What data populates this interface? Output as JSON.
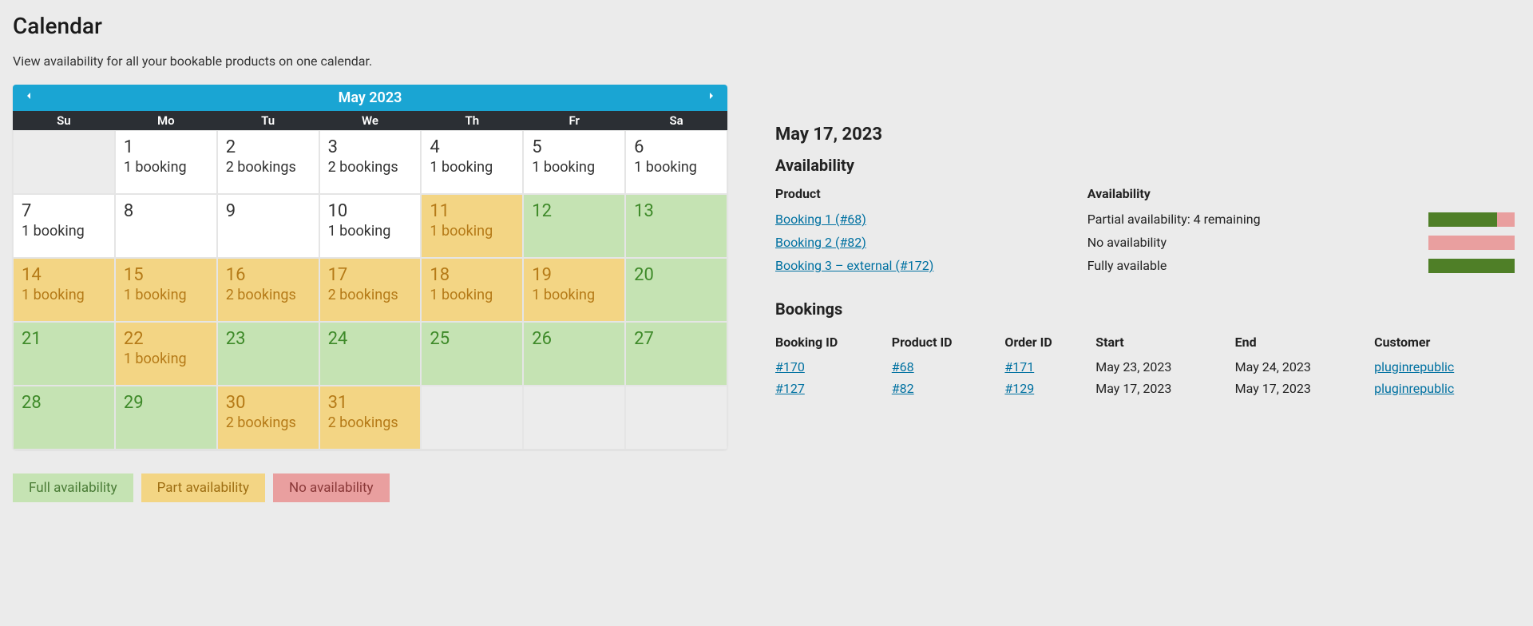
{
  "page": {
    "title": "Calendar",
    "subtitle": "View availability for all your bookable products on one calendar."
  },
  "calendar": {
    "month_label": "May 2023",
    "day_headers": [
      "Su",
      "Mo",
      "Tu",
      "We",
      "Th",
      "Fr",
      "Sa"
    ],
    "cells": [
      {
        "day": "",
        "status": "blank",
        "text": ""
      },
      {
        "day": "1",
        "status": "none",
        "text": "1 booking"
      },
      {
        "day": "2",
        "status": "none",
        "text": "2 bookings"
      },
      {
        "day": "3",
        "status": "none",
        "text": "2 bookings"
      },
      {
        "day": "4",
        "status": "none",
        "text": "1 booking"
      },
      {
        "day": "5",
        "status": "none",
        "text": "1 booking"
      },
      {
        "day": "6",
        "status": "none",
        "text": "1 booking"
      },
      {
        "day": "7",
        "status": "none",
        "text": "1 booking"
      },
      {
        "day": "8",
        "status": "none",
        "text": ""
      },
      {
        "day": "9",
        "status": "none",
        "text": ""
      },
      {
        "day": "10",
        "status": "none",
        "text": "1 booking"
      },
      {
        "day": "11",
        "status": "orange",
        "text": "1 booking"
      },
      {
        "day": "12",
        "status": "green",
        "text": ""
      },
      {
        "day": "13",
        "status": "green",
        "text": ""
      },
      {
        "day": "14",
        "status": "orange",
        "text": "1 booking"
      },
      {
        "day": "15",
        "status": "orange",
        "text": "1 booking"
      },
      {
        "day": "16",
        "status": "orange",
        "text": "2 bookings"
      },
      {
        "day": "17",
        "status": "orange",
        "text": "2 bookings"
      },
      {
        "day": "18",
        "status": "orange",
        "text": "1 booking"
      },
      {
        "day": "19",
        "status": "orange",
        "text": "1 booking"
      },
      {
        "day": "20",
        "status": "green",
        "text": ""
      },
      {
        "day": "21",
        "status": "green",
        "text": ""
      },
      {
        "day": "22",
        "status": "orange",
        "text": "1 booking"
      },
      {
        "day": "23",
        "status": "green",
        "text": ""
      },
      {
        "day": "24",
        "status": "green",
        "text": ""
      },
      {
        "day": "25",
        "status": "green",
        "text": ""
      },
      {
        "day": "26",
        "status": "green",
        "text": ""
      },
      {
        "day": "27",
        "status": "green",
        "text": ""
      },
      {
        "day": "28",
        "status": "green",
        "text": ""
      },
      {
        "day": "29",
        "status": "green",
        "text": ""
      },
      {
        "day": "30",
        "status": "orange",
        "text": "2 bookings"
      },
      {
        "day": "31",
        "status": "orange",
        "text": "2 bookings"
      },
      {
        "day": "",
        "status": "blank",
        "text": ""
      },
      {
        "day": "",
        "status": "blank",
        "text": ""
      },
      {
        "day": "",
        "status": "blank",
        "text": ""
      }
    ]
  },
  "legend": {
    "full": "Full availability",
    "part": "Part availability",
    "none": "No availability"
  },
  "details": {
    "date": "May 17, 2023",
    "availability_title": "Availability",
    "product_header": "Product",
    "availability_header": "Availability",
    "products": [
      {
        "name": "Booking 1 (#68)",
        "status": "Partial availability: 4 remaining",
        "green": 0.8,
        "red": 0.2
      },
      {
        "name": "Booking 2 (#82)",
        "status": "No availability",
        "green": 0,
        "red": 1
      },
      {
        "name": "Booking 3 – external (#172)",
        "status": "Fully available",
        "green": 1,
        "red": 0
      }
    ],
    "bookings_title": "Bookings",
    "bookings_headers": {
      "booking_id": "Booking ID",
      "product_id": "Product ID",
      "order_id": "Order ID",
      "start": "Start",
      "end": "End",
      "customer": "Customer"
    },
    "bookings": [
      {
        "booking_id": "#170",
        "product_id": "#68",
        "order_id": "#171",
        "start": "May 23, 2023",
        "end": "May 24, 2023",
        "customer": "pluginrepublic"
      },
      {
        "booking_id": "#127",
        "product_id": "#82",
        "order_id": "#129",
        "start": "May 17, 2023",
        "end": "May 17, 2023",
        "customer": "pluginrepublic"
      }
    ]
  }
}
